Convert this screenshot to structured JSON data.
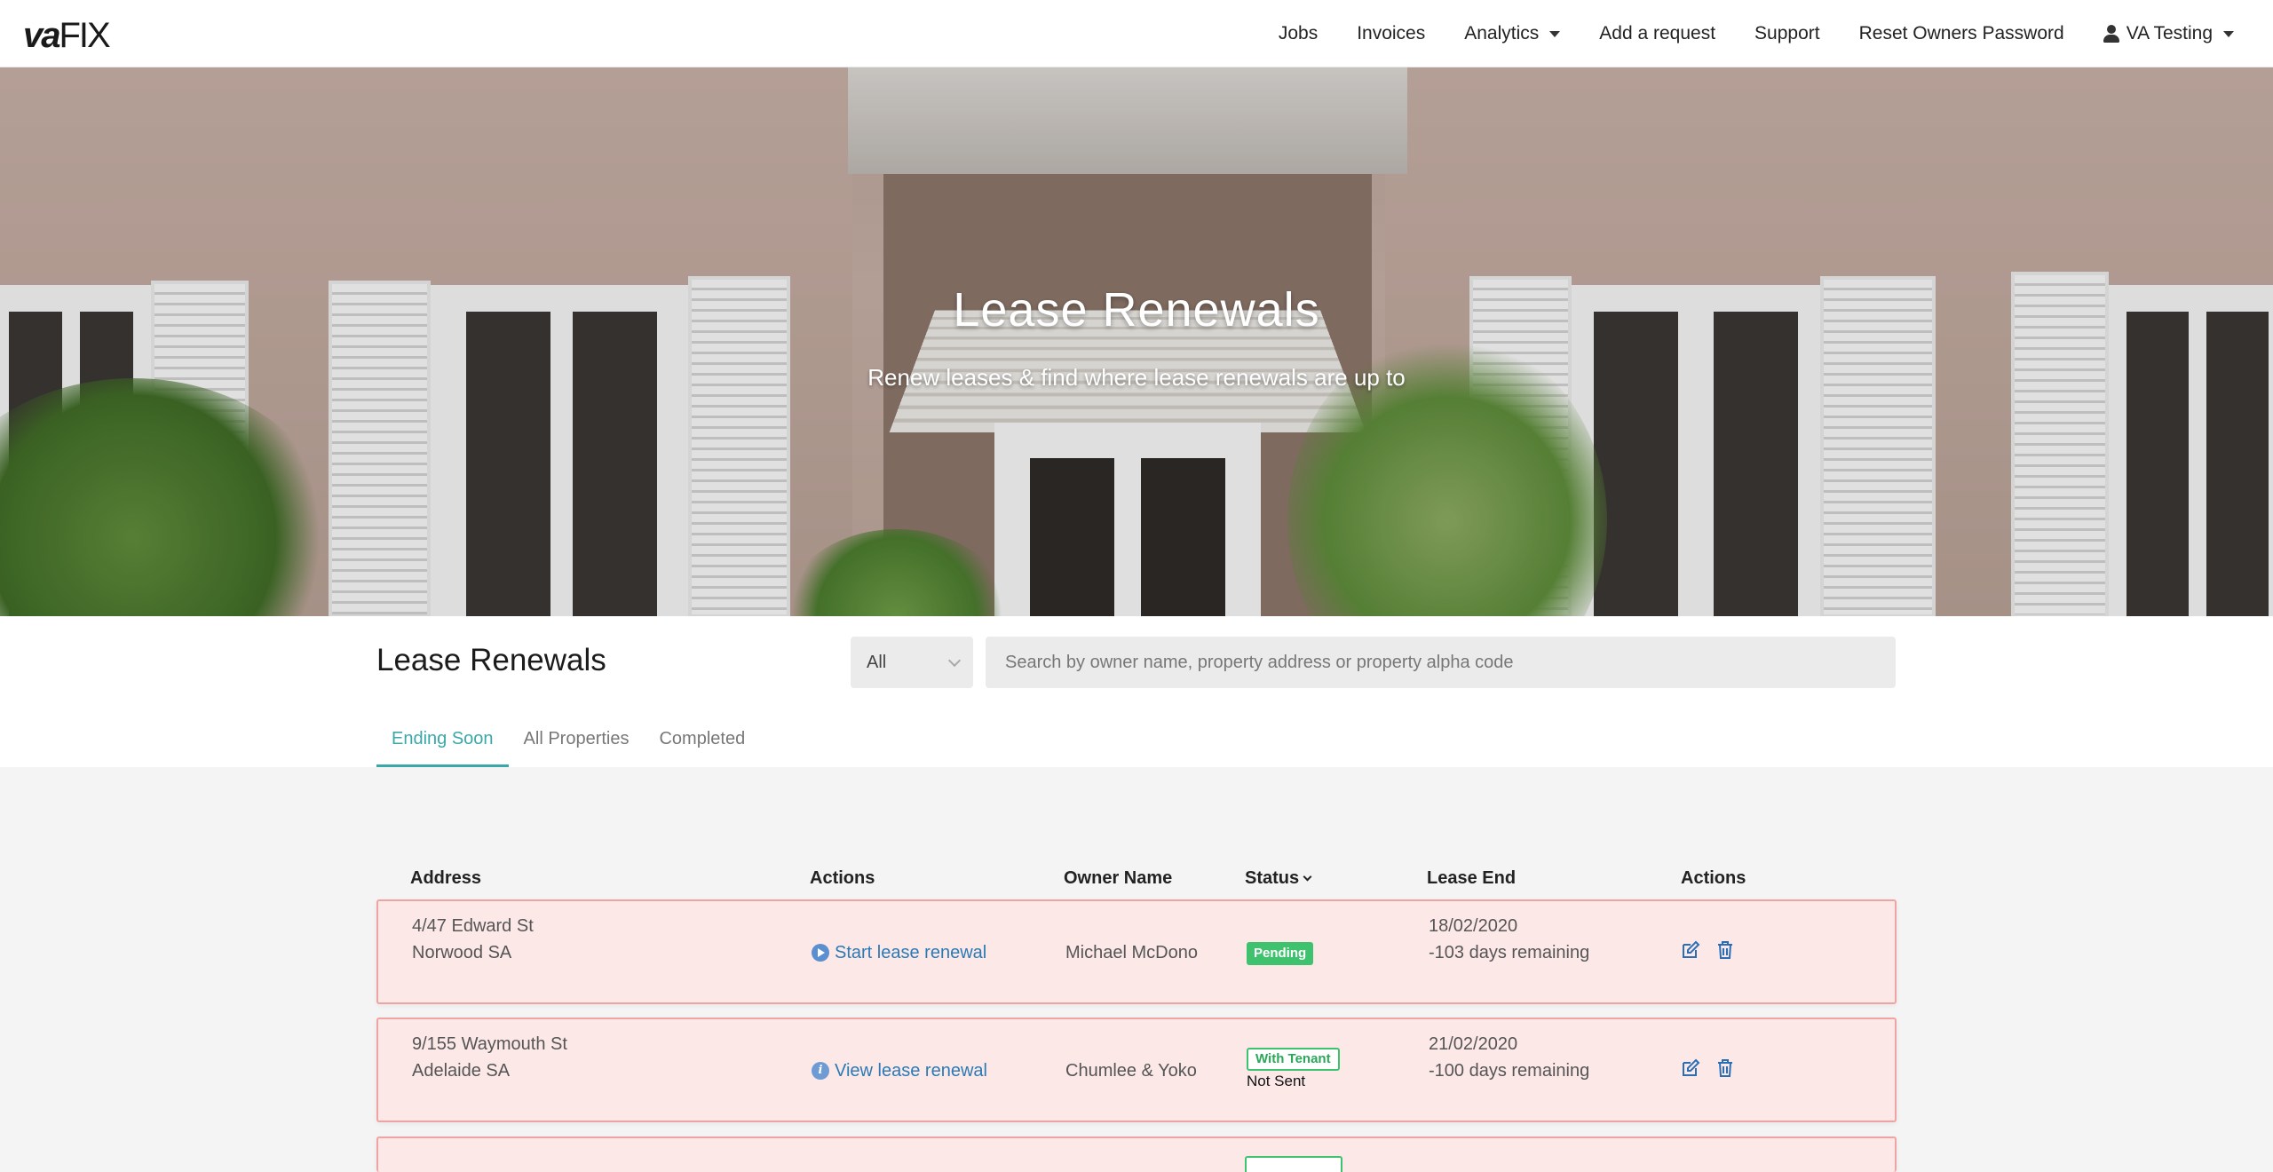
{
  "app": {
    "logo_bold": "va",
    "logo_thin": "FIX"
  },
  "nav": {
    "items": [
      {
        "label": "Jobs"
      },
      {
        "label": "Invoices"
      },
      {
        "label": "Analytics"
      },
      {
        "label": "Add a request"
      },
      {
        "label": "Support"
      },
      {
        "label": "Reset Owners Password"
      },
      {
        "label": "VA Testing"
      }
    ]
  },
  "hero": {
    "title": "Lease Renewals",
    "subtitle": "Renew leases & find where lease renewals are up to"
  },
  "header": {
    "title": "Lease Renewals",
    "filter_value": "All",
    "search_placeholder": "Search by owner name, property address or property alpha code"
  },
  "tabs": [
    {
      "label": "Ending Soon",
      "active": true
    },
    {
      "label": "All Properties",
      "active": false
    },
    {
      "label": "Completed",
      "active": false
    }
  ],
  "table": {
    "columns": [
      "Address",
      "Actions",
      "Owner Name",
      "Status",
      "Lease End",
      "Actions"
    ],
    "rows": [
      {
        "address_line1": "4/47 Edward St",
        "address_line2": "Norwood SA",
        "action": "Start lease renewal",
        "action_icon": "play-circle-icon",
        "owner": "Michael McDono",
        "status": "Pending",
        "sub_status": "",
        "lease_end": "18/02/2020",
        "remaining": "-103 days remaining"
      },
      {
        "address_line1": "9/155 Waymouth St",
        "address_line2": "Adelaide SA",
        "action": "View lease renewal",
        "action_icon": "info-circle-icon",
        "owner": "Chumlee & Yoko",
        "status": "With Tenant",
        "sub_status": "Not Sent",
        "lease_end": "21/02/2020",
        "remaining": "-100 days remaining"
      }
    ]
  },
  "colors": {
    "accent": "#3aa8a8",
    "link": "#2a7ab5",
    "row_bg": "#fde8e8",
    "row_border": "#f0a3a3",
    "status_green": "#3ec26e"
  }
}
